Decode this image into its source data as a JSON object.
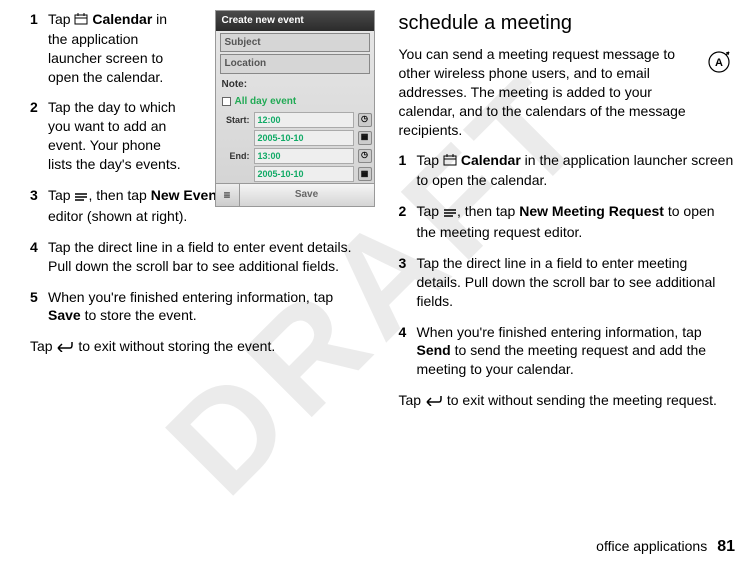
{
  "watermark": "DRAFT",
  "left": {
    "steps": [
      {
        "num": "1",
        "pre": "Tap ",
        "icon": "calendar-app-icon",
        "bold": "Calendar",
        "post": " in the application launcher screen to open the calendar."
      },
      {
        "num": "2",
        "text": "Tap the day to which you want to add an event. Your phone lists the day's events."
      },
      {
        "num": "3",
        "pre": "Tap ",
        "icon": "menu-icon",
        "mid": ", then tap ",
        "bold": "New Event",
        "post": " to open the new event editor (shown at right)."
      },
      {
        "num": "4",
        "text": "Tap the direct line in a field to enter event details. Pull down the scroll bar to see additional fields."
      },
      {
        "num": "5",
        "pre": "When you're finished entering information, tap ",
        "bold": "Save",
        "post": " to store the event."
      }
    ],
    "exit": {
      "pre": "Tap ",
      "icon": "back-icon",
      "post": " to exit without storing the event."
    }
  },
  "phone": {
    "title": "Create new event",
    "subject_placeholder": "Subject",
    "location_placeholder": "Location",
    "note_label": "Note:",
    "allday_label": "All day event",
    "start_label": "Start:",
    "start_time": "12:00",
    "start_date": "2005-10-10",
    "end_label": "End:",
    "end_time": "13:00",
    "end_date": "2005-10-10",
    "save_label": "Save"
  },
  "right": {
    "title": "schedule a meeting",
    "intro": "You can send a meeting request message to other wireless phone users, and to email addresses. The meeting is added to your calendar, and to the calendars of the message recipients.",
    "steps": [
      {
        "num": "1",
        "pre": "Tap ",
        "icon": "calendar-app-icon",
        "bold": "Calendar",
        "post": " in the application launcher screen to open the calendar."
      },
      {
        "num": "2",
        "pre": "Tap ",
        "icon": "menu-icon",
        "mid": ", then tap ",
        "bold": "New Meeting Request",
        "post": " to open the meeting request editor."
      },
      {
        "num": "3",
        "text": "Tap the direct line in a field to enter meeting details. Pull down the scroll bar to see additional fields."
      },
      {
        "num": "4",
        "pre": "When you're finished entering information, tap ",
        "bold": "Send",
        "post": " to send the meeting request and add the meeting to your calendar."
      }
    ],
    "exit": {
      "pre": "Tap ",
      "icon": "back-icon",
      "post": " to exit without sending the meeting request."
    }
  },
  "footer": {
    "section": "office applications",
    "page": "81"
  },
  "badge_letter": "A"
}
